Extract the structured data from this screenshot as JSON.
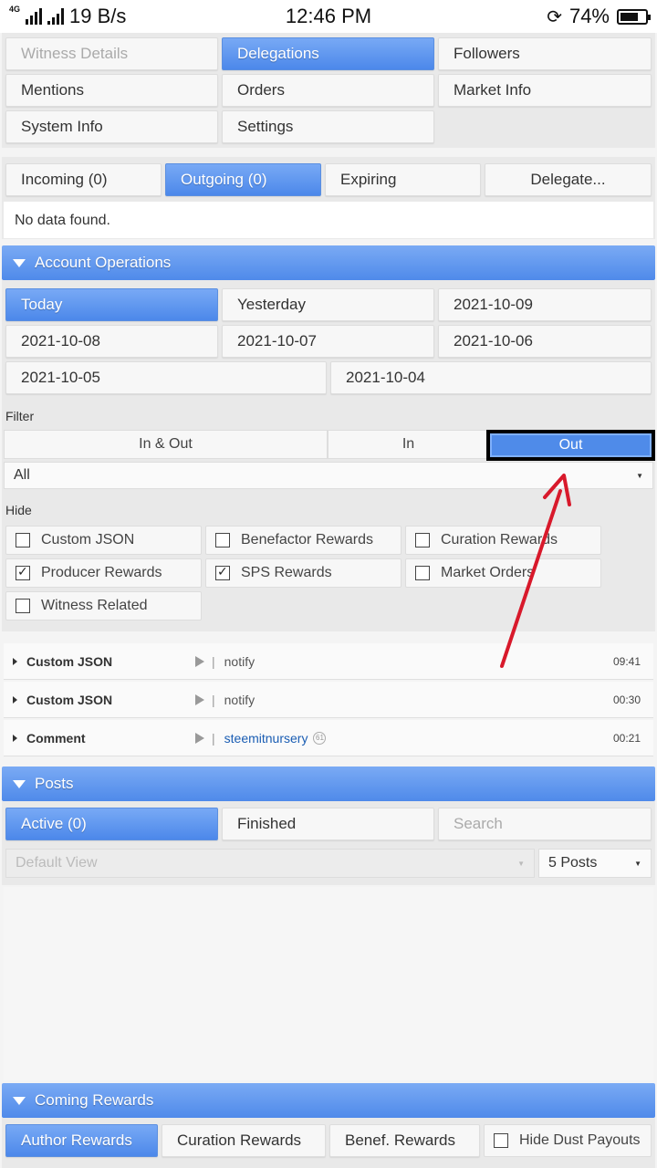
{
  "status": {
    "network": "4G",
    "speed": "19 B/s",
    "time": "12:46 PM",
    "battery": "74%",
    "battery_level": 0.74
  },
  "top_tabs": [
    {
      "label": "Witness Details",
      "state": "disabled"
    },
    {
      "label": "Delegations",
      "state": "active"
    },
    {
      "label": "Followers",
      "state": "normal"
    },
    {
      "label": "Mentions",
      "state": "normal"
    },
    {
      "label": "Orders",
      "state": "normal"
    },
    {
      "label": "Market Info",
      "state": "normal"
    },
    {
      "label": "System Info",
      "state": "normal"
    },
    {
      "label": "Settings",
      "state": "normal"
    }
  ],
  "delegation_tabs": {
    "incoming": "Incoming (0)",
    "outgoing": "Outgoing (0)",
    "expiring": "Expiring",
    "delegate": "Delegate..."
  },
  "no_data": "No data found.",
  "account_operations": {
    "title": "Account Operations",
    "dates": [
      "Today",
      "Yesterday",
      "2021-10-09",
      "2021-10-08",
      "2021-10-07",
      "2021-10-06",
      "2021-10-05",
      "2021-10-04"
    ],
    "filter_label": "Filter",
    "filter_options": {
      "in_out": "In & Out",
      "in": "In",
      "out": "Out"
    },
    "filter_select": "All",
    "hide_label": "Hide",
    "hide_options": [
      {
        "label": "Custom JSON",
        "checked": false
      },
      {
        "label": "Benefactor Rewards",
        "checked": false
      },
      {
        "label": "Curation Rewards",
        "checked": false
      },
      {
        "label": "Producer Rewards",
        "checked": true
      },
      {
        "label": "SPS Rewards",
        "checked": true
      },
      {
        "label": "Market Orders",
        "checked": false
      },
      {
        "label": "Witness Related",
        "checked": false
      }
    ],
    "operations": [
      {
        "type": "Custom JSON",
        "desc": "notify",
        "time": "09:41"
      },
      {
        "type": "Custom JSON",
        "desc": "notify",
        "time": "00:30"
      },
      {
        "type": "Comment",
        "desc": "steemitnursery",
        "rep": "61",
        "time": "00:21"
      }
    ]
  },
  "posts": {
    "title": "Posts",
    "tabs": {
      "active": "Active (0)",
      "finished": "Finished"
    },
    "search_placeholder": "Search",
    "view_select": "Default View",
    "count_select": "5 Posts"
  },
  "coming_rewards": {
    "title": "Coming Rewards",
    "tabs": {
      "author": "Author Rewards",
      "curation": "Curation Rewards",
      "benef": "Benef. Rewards"
    },
    "hide_dust": "Hide Dust Payouts"
  },
  "colors": {
    "accent": "#4f8aea",
    "annotation": "#d8192b"
  }
}
